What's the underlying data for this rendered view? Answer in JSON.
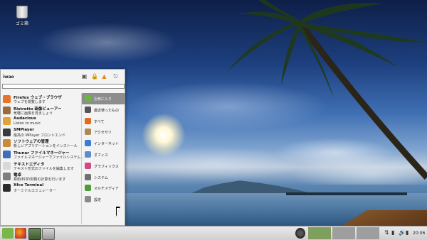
{
  "desktop": {
    "trash_label": "ゴミ箱"
  },
  "menu": {
    "user_name": "iwao",
    "search_value": "",
    "header_icons": [
      "computer-icon",
      "lock-icon",
      "logout-icon",
      "power-icon"
    ],
    "apps": [
      {
        "title": "Firefox ウェブ・ブラウザ",
        "desc": "ウェブを閲覧します",
        "color": "#e8742a"
      },
      {
        "title": "Ristretto 画像ビューアー",
        "desc": "気軽に画像を見ましょう",
        "color": "#9a6b3c"
      },
      {
        "title": "Audacious",
        "desc": "Listen to music",
        "color": "#e2a23a"
      },
      {
        "title": "SMPlayer",
        "desc": "最高の MPlayer フロントエンド",
        "color": "#3a3a3a"
      },
      {
        "title": "ソフトウェアの管理",
        "desc": "新しいアプリケーションをインストール",
        "color": "#c98a3a"
      },
      {
        "title": "Thunar ファイルマネージャー",
        "desc": "ファイルマネージャーでファイルシステム...",
        "color": "#3d6fb8"
      },
      {
        "title": "テキストエディタ",
        "desc": "テキスト形式のファイルを編集します",
        "color": "#d8d8d8"
      },
      {
        "title": "電卓",
        "desc": "算術/科学/財務の計算を行います",
        "color": "#7e7e7e"
      },
      {
        "title": "Xfce Terminal",
        "desc": "ターミナルエミュレーター",
        "color": "#2b2b2b"
      }
    ],
    "categories": [
      {
        "label": "お気に入り",
        "color": "#6bb73c",
        "active": true
      },
      {
        "label": "最近使ったもの",
        "color": "#555555",
        "active": false
      },
      {
        "label": "すべて",
        "color": "#e06a1a",
        "active": false
      },
      {
        "label": "アクセサリ",
        "color": "#b08850",
        "active": false
      },
      {
        "label": "インターネット",
        "color": "#3b7bd4",
        "active": false
      },
      {
        "label": "オフィス",
        "color": "#5a8dd0",
        "active": false
      },
      {
        "label": "グラフィックス",
        "color": "#d04a8a",
        "active": false
      },
      {
        "label": "システム",
        "color": "#707070",
        "active": false
      },
      {
        "label": "マルチメディア",
        "color": "#4f9a3a",
        "active": false
      },
      {
        "label": "設定",
        "color": "#8a8a8a",
        "active": false
      }
    ]
  },
  "taskbar": {
    "clock": "20:06",
    "colors": {
      "workspace_active": "#7f9f5f",
      "workspace_inactive": "#9e9e9e",
      "mint": "#7ab648"
    }
  }
}
